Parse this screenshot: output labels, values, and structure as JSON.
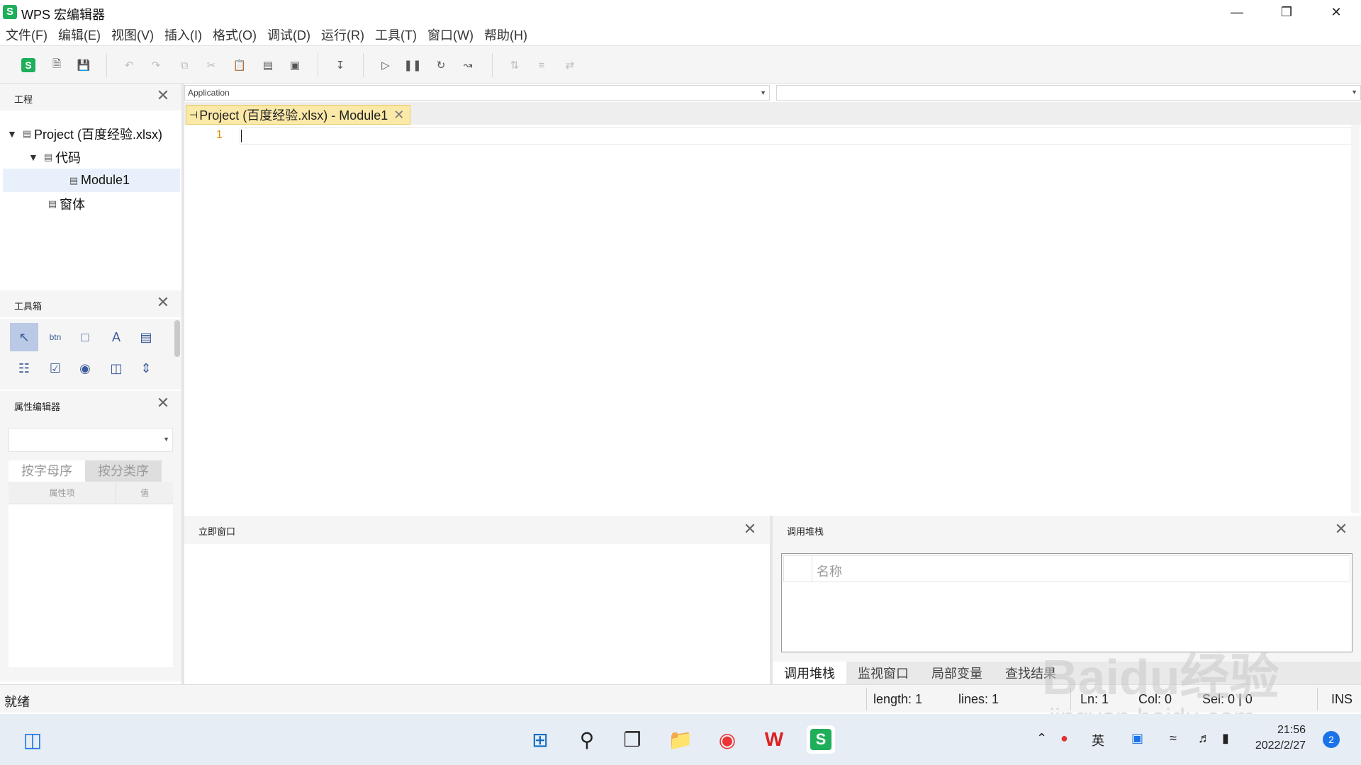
{
  "window": {
    "logo": "S",
    "title": "WPS 宏编辑器",
    "controls": [
      "minimize-icon",
      "restore-icon",
      "close-icon"
    ]
  },
  "menu": [
    "文件(F)",
    "编辑(E)",
    "视图(V)",
    "插入(I)",
    "格式(O)",
    "调试(D)",
    "运行(R)",
    "工具(T)",
    "窗口(W)",
    "帮助(H)"
  ],
  "project_panel": {
    "title": "工程",
    "tree": [
      {
        "label": "Project (百度经验.xlsx)",
        "level": 0,
        "expanded": true
      },
      {
        "label": "代码",
        "level": 1,
        "expanded": true
      },
      {
        "label": "Module1",
        "level": 2,
        "selected": true
      },
      {
        "label": "窗体",
        "level": 1
      }
    ]
  },
  "toolbox_panel": {
    "title": "工具箱",
    "tools": [
      "pointer-icon",
      "button-tool-icon",
      "textbox-tool-icon",
      "label-tool-icon",
      "frame-tool-icon",
      "listbox-tool-icon",
      "checkbox-tool-icon",
      "radio-tool-icon",
      "scrollbar-tool-icon",
      "spin-tool-icon"
    ]
  },
  "properties_panel": {
    "title": "属性编辑器",
    "tab_alpha": "按字母序",
    "tab_category": "按分类序",
    "col_name": "属性项",
    "col_value": "值"
  },
  "editor": {
    "object_combo": "Application",
    "tab_label": "Project (百度经验.xlsx) - Module1",
    "line_number": "1"
  },
  "immediate_panel": {
    "title": "立即窗口"
  },
  "callstack_panel": {
    "title": "调用堆栈",
    "col_name": "名称",
    "tabs": [
      "调用堆栈",
      "监视窗口",
      "局部变量",
      "查找结果"
    ]
  },
  "statusbar": {
    "ready": "就绪",
    "length": "length: 1",
    "lines": "lines: 1",
    "ln": "Ln: 1",
    "col": "Col: 0",
    "sel": "Sel: 0 | 0",
    "ins": "INS"
  },
  "watermark": {
    "text": "Baidu经验",
    "url": "jingyan.baidu.com"
  },
  "taskbar": {
    "time": "21:56",
    "date": "2022/2/27",
    "ime": "英",
    "notifications": "2"
  },
  "colors": {
    "accent_green": "#1fae5a",
    "tab_yellow": "#fbe9a8",
    "line_number": "#e08a00"
  }
}
